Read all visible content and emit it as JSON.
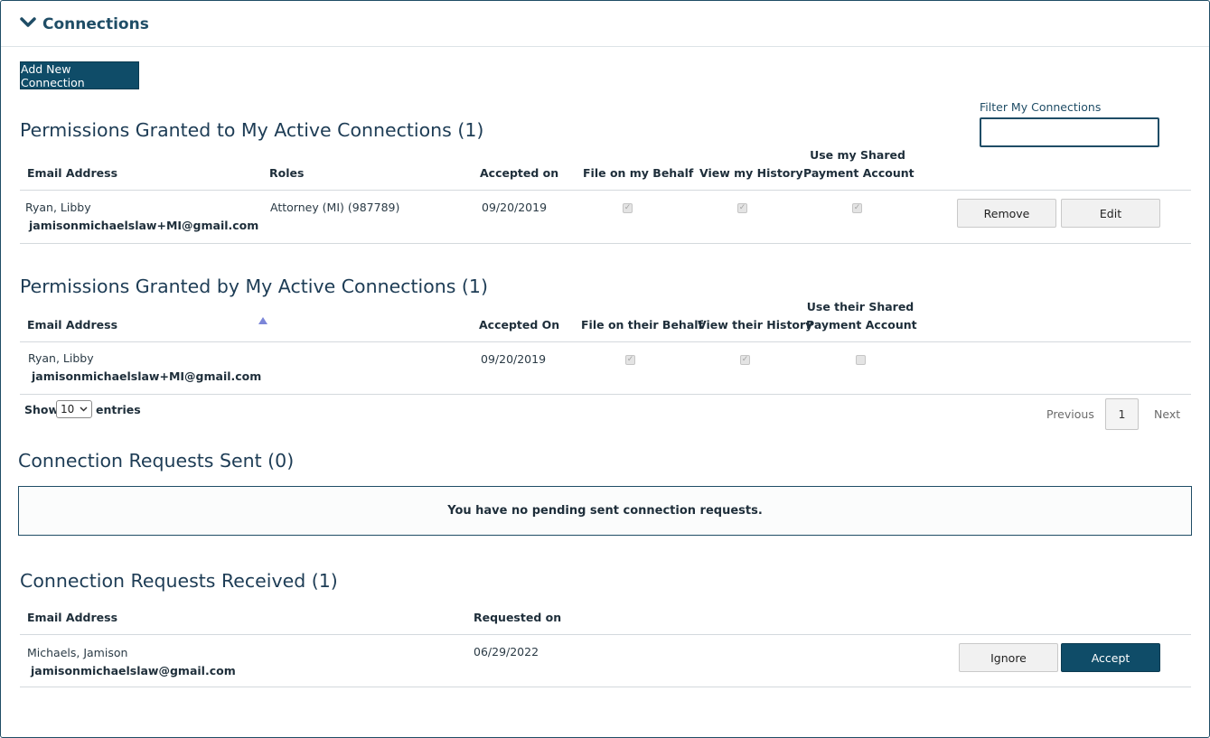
{
  "panel": {
    "title": "Connections",
    "toggle_icon": "chevron-down-icon"
  },
  "add_button": "Add New Connection",
  "filter": {
    "label": "Filter My Connections",
    "value": "",
    "placeholder": ""
  },
  "granted_to": {
    "heading": "Permissions Granted to My Active Connections (1)",
    "columns": [
      "Email Address",
      "Roles",
      "Accepted on",
      "File on my Behalf",
      "View my History",
      "Use my Shared",
      "Payment Account"
    ],
    "rows": [
      {
        "name": "Ryan, Libby",
        "email": "jamisonmichaelslaw+MI@gmail.com",
        "role": "Attorney (MI) (987789)",
        "accepted": "09/20/2019",
        "file": true,
        "history": true,
        "payment": true,
        "remove": "Remove",
        "edit": "Edit"
      }
    ]
  },
  "granted_by": {
    "heading": "Permissions Granted by My Active Connections (1)",
    "columns": [
      "Email Address",
      "Accepted On",
      "File on their Behalf",
      "View their History",
      "Use their Shared",
      "Payment Account"
    ],
    "sort_icon": "sort-ascending-icon",
    "rows": [
      {
        "name": "Ryan, Libby",
        "email": "jamisonmichaelslaw+MI@gmail.com",
        "accepted": "09/20/2019",
        "file": true,
        "history": true,
        "payment": false
      }
    ],
    "length": {
      "show": "Show",
      "value": "10",
      "entries": "entries"
    },
    "pagination": {
      "previous": "Previous",
      "page": "1",
      "next": "Next"
    }
  },
  "requests_sent": {
    "heading": "Connection Requests Sent (0)",
    "empty_message": "You have no pending sent connection requests."
  },
  "requests_received": {
    "heading": "Connection Requests Received (1)",
    "columns": [
      "Email Address",
      "Requested on"
    ],
    "rows": [
      {
        "name": "Michaels, Jamison",
        "email": "jamisonmichaelslaw@gmail.com",
        "requested": "06/29/2022",
        "ignore": "Ignore",
        "accept": "Accept"
      }
    ]
  }
}
